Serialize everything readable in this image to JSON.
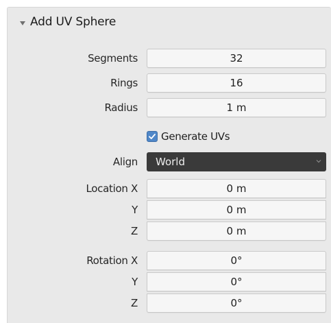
{
  "panel": {
    "title": "Add UV Sphere"
  },
  "fields": {
    "segments": {
      "label": "Segments",
      "value": "32"
    },
    "rings": {
      "label": "Rings",
      "value": "16"
    },
    "radius": {
      "label": "Radius",
      "value": "1 m"
    }
  },
  "generate_uvs": {
    "label": "Generate UVs",
    "checked": true
  },
  "align": {
    "label": "Align",
    "value": "World"
  },
  "location": {
    "x_label": "Location X",
    "x": "0 m",
    "y_label": "Y",
    "y": "0 m",
    "z_label": "Z",
    "z": "0 m"
  },
  "rotation": {
    "x_label": "Rotation X",
    "x": "0°",
    "y_label": "Y",
    "y": "0°",
    "z_label": "Z",
    "z": "0°"
  },
  "colors": {
    "panel_bg": "#e9e9e9",
    "field_bg": "#f6f6f6",
    "select_bg": "#3a3a3a",
    "checkbox_accent": "#4f87c8"
  },
  "icons": {
    "collapse": "triangle-down-icon",
    "check": "check-icon",
    "dropdown": "chevron-down-icon"
  }
}
